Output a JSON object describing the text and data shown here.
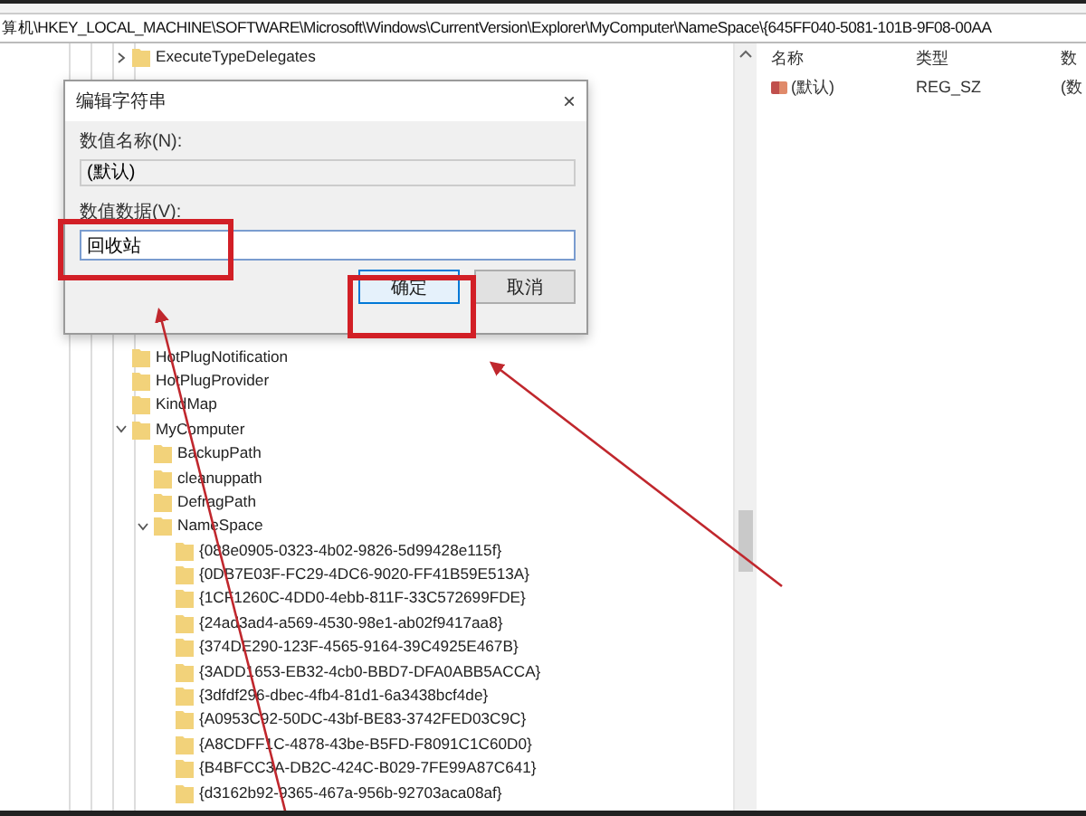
{
  "address_bar": {
    "path": "算机\\HKEY_LOCAL_MACHINE\\SOFTWARE\\Microsoft\\Windows\\CurrentVersion\\Explorer\\MyComputer\\NameSpace\\{645FF040-5081-101B-9F08-00AA"
  },
  "tree": {
    "items": [
      {
        "label": "ExecuteTypeDelegates",
        "expanded": false
      },
      {
        "label": "HotPlugNotification"
      },
      {
        "label": "HotPlugProvider"
      },
      {
        "label": "KindMap"
      },
      {
        "label": "MyComputer",
        "expanded": true,
        "children": [
          {
            "label": "BackupPath"
          },
          {
            "label": "cleanuppath"
          },
          {
            "label": "DefragPath"
          },
          {
            "label": "NameSpace",
            "expanded": true,
            "children": [
              {
                "label": "{088e0905-0323-4b02-9826-5d99428e115f}"
              },
              {
                "label": "{0DB7E03F-FC29-4DC6-9020-FF41B59E513A}"
              },
              {
                "label": "{1CF1260C-4DD0-4ebb-811F-33C572699FDE}"
              },
              {
                "label": "{24ad3ad4-a569-4530-98e1-ab02f9417aa8}"
              },
              {
                "label": "{374DE290-123F-4565-9164-39C4925E467B}"
              },
              {
                "label": "{3ADD1653-EB32-4cb0-BBD7-DFA0ABB5ACCA}"
              },
              {
                "label": "{3dfdf296-dbec-4fb4-81d1-6a3438bcf4de}"
              },
              {
                "label": "{A0953C92-50DC-43bf-BE83-3742FED03C9C}"
              },
              {
                "label": "{A8CDFF1C-4878-43be-B5FD-F8091C1C60D0}"
              },
              {
                "label": "{B4BFCC3A-DB2C-424C-B029-7FE99A87C641}"
              },
              {
                "label": "{d3162b92-9365-467a-956b-92703aca08af}"
              }
            ]
          }
        ]
      }
    ]
  },
  "values_pane": {
    "columns": [
      "名称",
      "类型",
      "数"
    ],
    "rows": [
      {
        "name": "(默认)",
        "type": "REG_SZ",
        "data": "(数"
      }
    ]
  },
  "dialog": {
    "title": "编辑字符串",
    "close": "×",
    "name_label": "数值名称(N):",
    "name_value": "(默认)",
    "data_label": "数值数据(V):",
    "data_value": "回收站",
    "buttons": [
      {
        "label": "确定",
        "selected": true
      },
      {
        "label": "取消",
        "selected": false
      }
    ]
  }
}
